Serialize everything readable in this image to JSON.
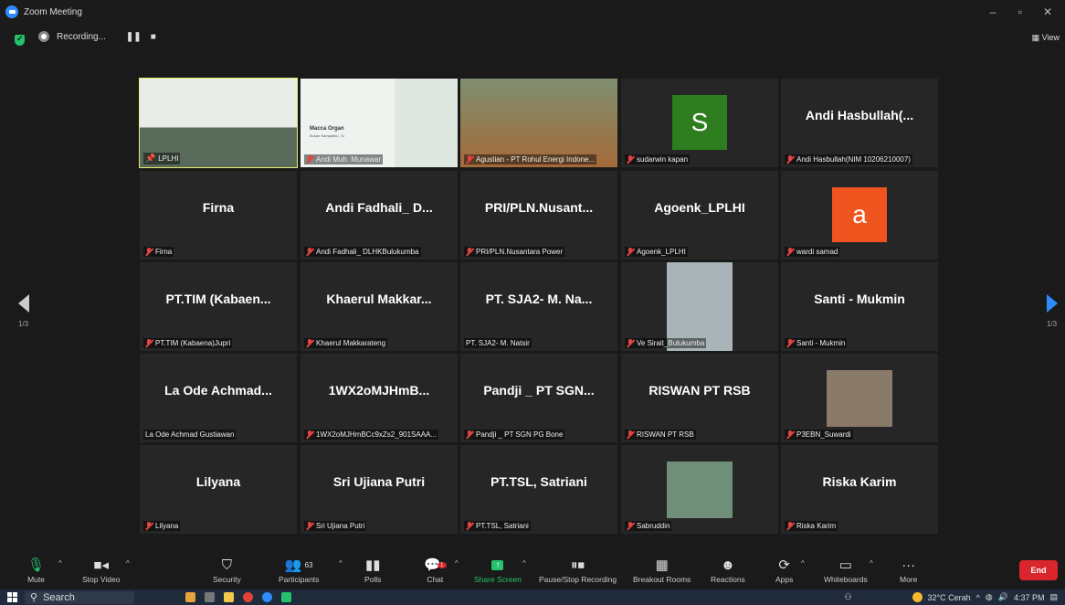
{
  "window": {
    "title": "Zoom Meeting"
  },
  "status": {
    "recording_label": "Recording...",
    "view_label": "View"
  },
  "pagination": {
    "left_page": "1/3",
    "right_page": "1/3"
  },
  "tiles": [
    {
      "name": "",
      "label": "LPLHI",
      "kind": "video",
      "muted": false,
      "pinned": true,
      "active": true
    },
    {
      "name": "",
      "label": "Andi Muh. Munawar",
      "kind": "video",
      "muted": true,
      "pinned": false,
      "active": false,
      "banner": "Macca Organ",
      "banner_sub": "Bukan Sampahku, Tu"
    },
    {
      "name": "",
      "label": "Agustian - PT Rohul Energi Indone...",
      "kind": "video",
      "muted": true,
      "pinned": false,
      "active": false
    },
    {
      "name": "",
      "label": "sudarwin kapan",
      "kind": "letter",
      "letter": "S",
      "letter_bg": "#2e7d1f",
      "muted": true
    },
    {
      "name": "Andi Hasbullah(...",
      "label": "Andi Hasbullah(NIM 10206210007)",
      "kind": "name",
      "muted": true
    },
    {
      "name": "Firna",
      "label": "Firna",
      "kind": "name",
      "muted": true
    },
    {
      "name": "Andi Fadhali_ D...",
      "label": "Andi Fadhali_ DLHKBulukumba",
      "kind": "name",
      "muted": true
    },
    {
      "name": "PRI/PLN.Nusant...",
      "label": "PRI/PLN.Nusantara Power",
      "kind": "name",
      "muted": true
    },
    {
      "name": "Agoenk_LPLHI",
      "label": "Agoenk_LPLHI",
      "kind": "name",
      "muted": true
    },
    {
      "name": "",
      "label": "wardi samad",
      "kind": "letter",
      "letter": "a",
      "letter_bg": "#f0541e",
      "muted": true
    },
    {
      "name": "PT.TIM (Kabaen...",
      "label": "PT.TIM (Kabaena)Jupri",
      "kind": "name",
      "muted": true
    },
    {
      "name": "Khaerul Makkar...",
      "label": "Khaerul Makkarateng",
      "kind": "name",
      "muted": true
    },
    {
      "name": "PT. SJA2- M. Na...",
      "label": "PT. SJA2- M. Natsir",
      "kind": "name",
      "muted": false
    },
    {
      "name": "",
      "label": "Ve Sirait_Bulukumba",
      "kind": "photo",
      "photo_color": "#a8b4b8",
      "muted": true
    },
    {
      "name": "Santi - Mukmin",
      "label": "Santi - Mukmin",
      "kind": "name",
      "muted": true
    },
    {
      "name": "La Ode Achmad...",
      "label": "La Ode Achmad Gustiawan",
      "kind": "name",
      "muted": false
    },
    {
      "name": "1WX2oMJHmB...",
      "label": "1WX2oMJHmBCc9xZs2_901SAAA...",
      "kind": "name",
      "muted": true
    },
    {
      "name": "Pandji _ PT SGN...",
      "label": "Pandji _ PT SGN PG Bone",
      "kind": "name",
      "muted": true
    },
    {
      "name": "RISWAN PT RSB",
      "label": "RISWAN PT RSB",
      "kind": "name",
      "muted": true
    },
    {
      "name": "",
      "label": "P3EBN_Suwardi",
      "kind": "photo",
      "photo_color": "#8a7a6a",
      "muted": true
    },
    {
      "name": "Lilyana",
      "label": "Lilyana",
      "kind": "name",
      "muted": true
    },
    {
      "name": "Sri Ujiana Putri",
      "label": "Sri Ujiana Putri",
      "kind": "name",
      "muted": true
    },
    {
      "name": "PT.TSL, Satriani",
      "label": "PT.TSL, Satriani",
      "kind": "name",
      "muted": true
    },
    {
      "name": "",
      "label": "Sabruddin",
      "kind": "photo",
      "photo_color": "#6f8f7a",
      "muted": true
    },
    {
      "name": "Riska Karim",
      "label": "Riska Karim",
      "kind": "name",
      "muted": true
    }
  ],
  "toolbar": {
    "mute": "Mute",
    "stop_video": "Stop Video",
    "security": "Security",
    "participants": "Participants",
    "participants_count": "63",
    "polls": "Polls",
    "chat": "Chat",
    "chat_badge": "1",
    "share_screen": "Share Screen",
    "pause_recording": "Pause/Stop Recording",
    "breakout_rooms": "Breakout Rooms",
    "reactions": "Reactions",
    "apps": "Apps",
    "whiteboards": "Whiteboards",
    "more": "More",
    "end": "End"
  },
  "taskbar": {
    "search": "Search",
    "weather": "32°C Cerah",
    "time": "4:37 PM"
  },
  "colors": {
    "accent": "#2d8cff",
    "end": "#d9262c",
    "share": "#25c26b",
    "active_outline": "#e8ec6e"
  }
}
